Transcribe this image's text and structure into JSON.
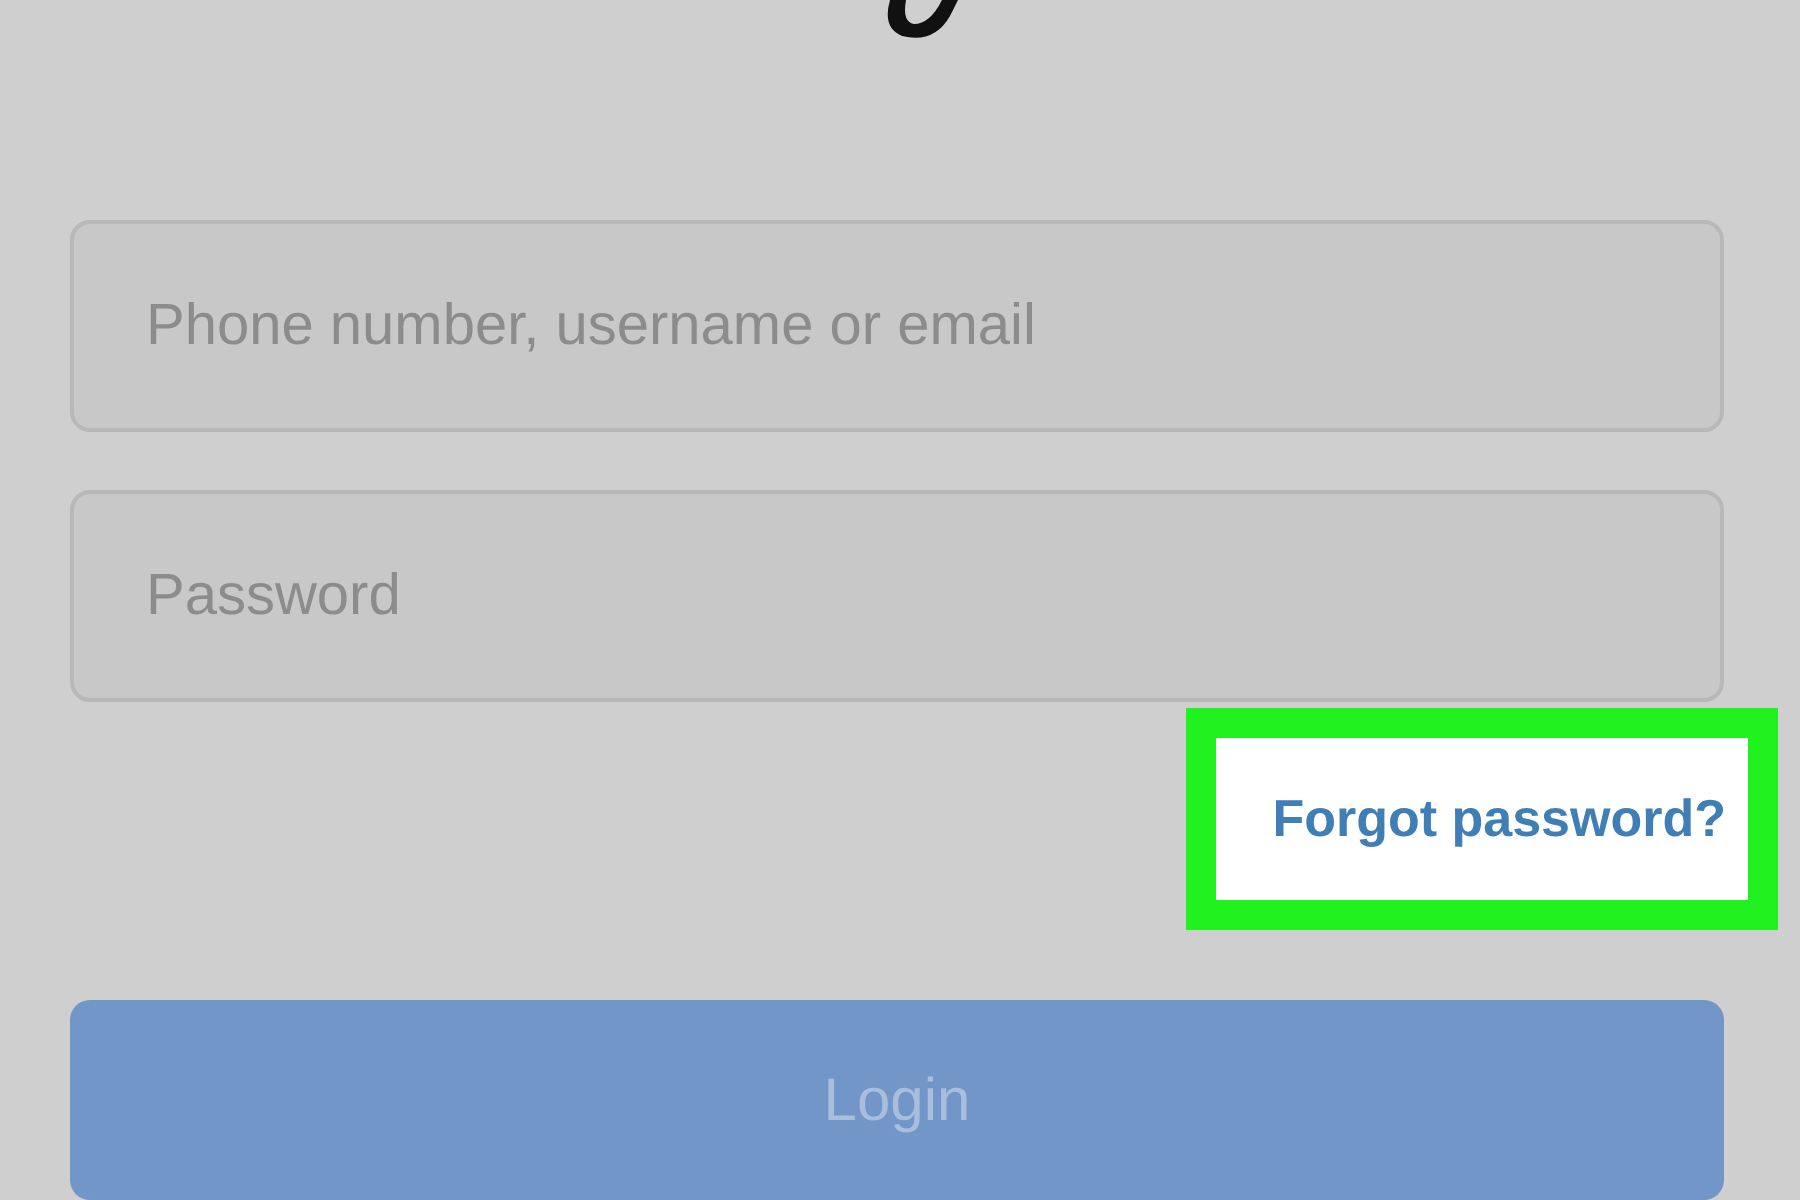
{
  "login_form": {
    "username_field": {
      "placeholder": "Phone number, username or email"
    },
    "password_field": {
      "placeholder": "Password"
    },
    "forgot_password_link": {
      "label": "Forgot password?",
      "highlighted": true
    },
    "login_button": {
      "label": "Login"
    }
  }
}
